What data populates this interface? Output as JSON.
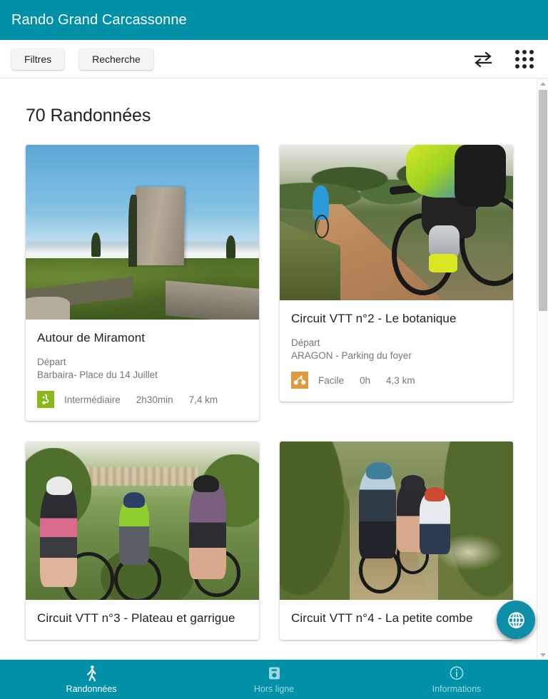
{
  "header": {
    "title": "Rando Grand Carcassonne",
    "background_color": "#0091a8"
  },
  "toolbar": {
    "filters_label": "Filtres",
    "search_label": "Recherche",
    "compare_icon": "swap-arrows-icon",
    "apps_icon": "apps-grid-icon"
  },
  "main": {
    "page_title": "70 Randonnées",
    "depart_label": "Départ",
    "cards": [
      {
        "title": "Autour de Miramont",
        "depart_label": "Départ",
        "depart_value": "Barbaira- Place du 14 Juillet",
        "activity_icon": "hiking-boot-icon",
        "activity_color": "#8cb81e",
        "difficulty": "Intermédiaire",
        "duration": "2h30min",
        "distance": "7,4 km",
        "photo": "ruined-tower-on-hill-above-clouds"
      },
      {
        "title": "Circuit VTT n°2 - Le botanique",
        "depart_label": "Départ",
        "depart_value": "ARAGON - Parking du foyer",
        "activity_icon": "mountain-bike-icon",
        "activity_color": "#e0993f",
        "difficulty": "Facile",
        "duration": "0h",
        "distance": "4,3 km",
        "photo": "mountain-bikers-on-forest-trail"
      },
      {
        "title": "Circuit VTT n°3 - Plateau et garrigue",
        "depart_label": "",
        "depart_value": "",
        "activity_icon": "",
        "activity_color": "",
        "difficulty": "",
        "duration": "",
        "distance": "",
        "photo": "cyclists-group-overlooking-valley"
      },
      {
        "title": "Circuit VTT n°4 - La petite combe",
        "depart_label": "",
        "depart_value": "",
        "activity_icon": "",
        "activity_color": "",
        "difficulty": "",
        "duration": "",
        "distance": "",
        "photo": "family-cycling-on-narrow-path"
      }
    ]
  },
  "fab": {
    "icon": "globe-icon",
    "color": "#0e8fa6"
  },
  "scrollbar": {
    "up_arrow": "scroll-up-arrow",
    "down_arrow": "scroll-down-arrow"
  },
  "bottom_nav": {
    "items": [
      {
        "label": "Randonnées",
        "icon": "walking-person-icon",
        "active": true
      },
      {
        "label": "Hors ligne",
        "icon": "save-floppy-icon",
        "active": false
      },
      {
        "label": "Informations",
        "icon": "info-circle-icon",
        "active": false
      }
    ]
  }
}
